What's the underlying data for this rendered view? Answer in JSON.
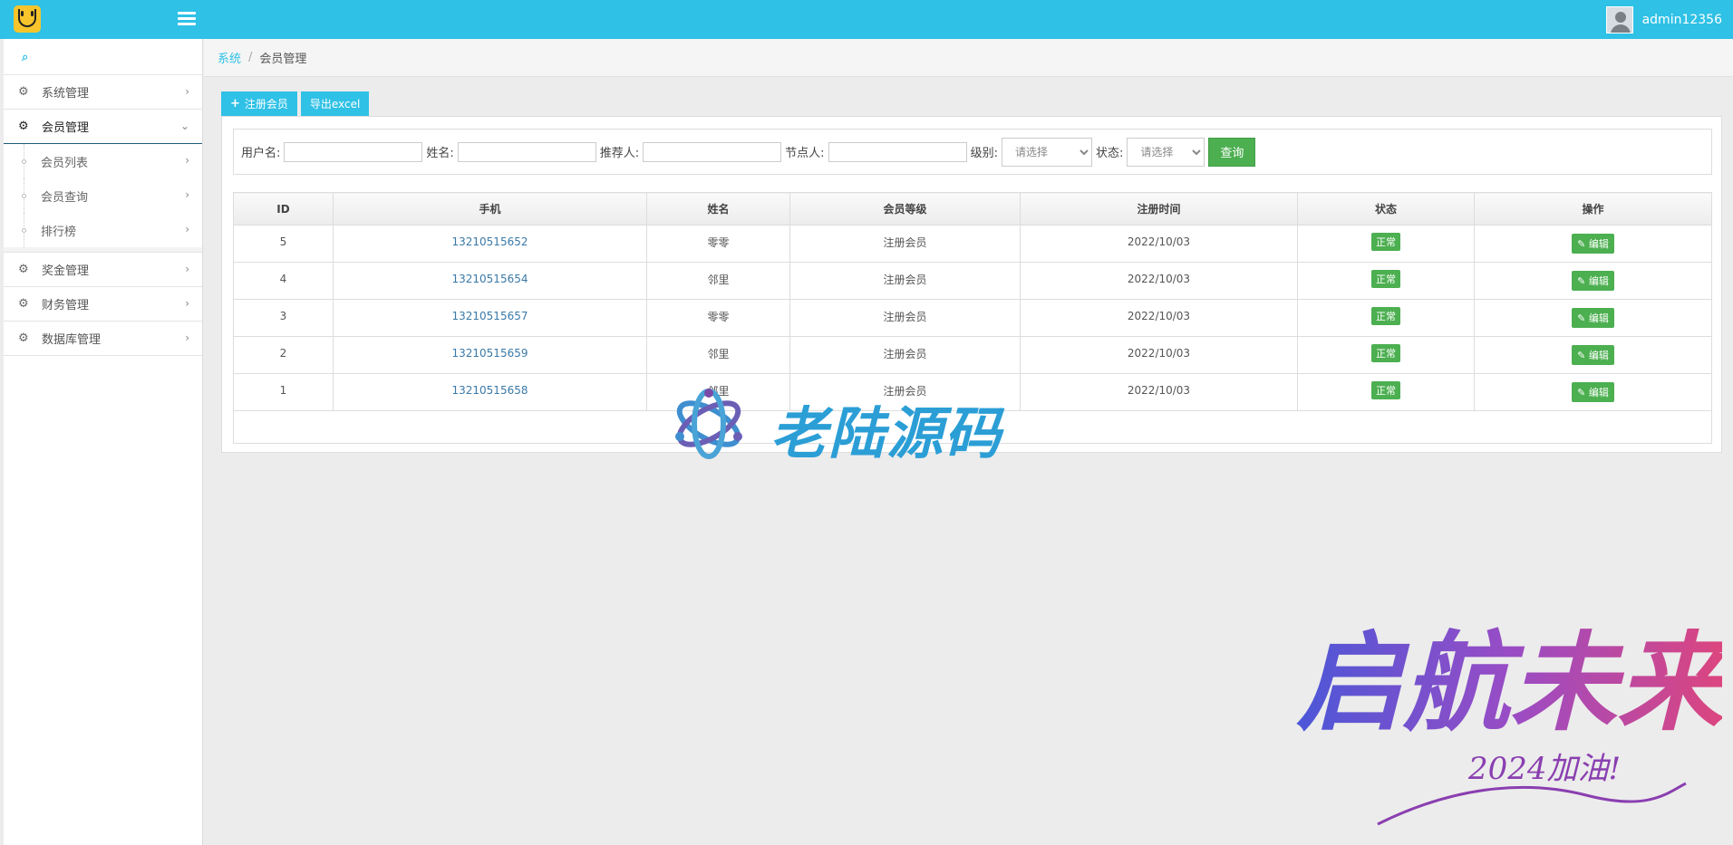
{
  "header": {
    "username": "admin12356"
  },
  "sidebar": {
    "items": [
      {
        "label": "系统管理"
      },
      {
        "label": "会员管理"
      },
      {
        "label": "奖金管理"
      },
      {
        "label": "财务管理"
      },
      {
        "label": "数据库管理"
      }
    ],
    "submenu": [
      {
        "label": "会员列表"
      },
      {
        "label": "会员查询"
      },
      {
        "label": "排行榜"
      }
    ]
  },
  "breadcrumb": {
    "parent": "系统",
    "current": "会员管理"
  },
  "toolbar": {
    "register_label": "注册会员",
    "export_label": "导出excel"
  },
  "filter": {
    "username_label": "用户名:",
    "name_label": "姓名:",
    "referrer_label": "推荐人:",
    "node_label": "节点人:",
    "level_label": "级别:",
    "level_value": "请选择",
    "status_label": "状态:",
    "status_value": "请选择",
    "query_label": "查询"
  },
  "table": {
    "headers": [
      "ID",
      "手机",
      "姓名",
      "会员等级",
      "注册时间",
      "状态",
      "操作"
    ],
    "rows": [
      {
        "id": "5",
        "phone": "13210515652",
        "name": "零零",
        "level": "注册会员",
        "date": "2022/10/03",
        "status": "正常",
        "action": "编辑"
      },
      {
        "id": "4",
        "phone": "13210515654",
        "name": "邻里",
        "level": "注册会员",
        "date": "2022/10/03",
        "status": "正常",
        "action": "编辑"
      },
      {
        "id": "3",
        "phone": "13210515657",
        "name": "零零",
        "level": "注册会员",
        "date": "2022/10/03",
        "status": "正常",
        "action": "编辑"
      },
      {
        "id": "2",
        "phone": "13210515659",
        "name": "邻里",
        "level": "注册会员",
        "date": "2022/10/03",
        "status": "正常",
        "action": "编辑"
      },
      {
        "id": "1",
        "phone": "13210515658",
        "name": "邻里",
        "level": "注册会员",
        "date": "2022/10/03",
        "status": "正常",
        "action": "编辑"
      }
    ]
  },
  "watermark": {
    "text": "老陆源码"
  },
  "promo": {
    "title": "启航未来",
    "subtitle": "2024加油!"
  },
  "colors": {
    "accent": "#2fc1e6",
    "success": "#4caf50",
    "link": "#3a79a8"
  }
}
